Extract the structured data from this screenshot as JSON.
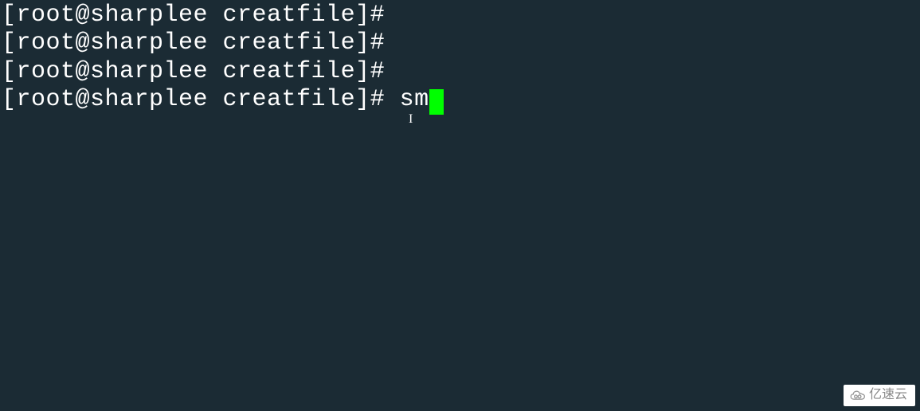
{
  "terminal": {
    "lines": [
      {
        "prompt": "[root@sharplee creatfile]# ",
        "command": ""
      },
      {
        "prompt": "[root@sharplee creatfile]# ",
        "command": ""
      },
      {
        "prompt": "[root@sharplee creatfile]# ",
        "command": ""
      },
      {
        "prompt": "[root@sharplee creatfile]# ",
        "command": "sm"
      }
    ],
    "cursor_color": "#00ff00",
    "background": "#1b2b34",
    "foreground": "#ffffff"
  },
  "text_cursor_mark": "I",
  "watermark": {
    "text": "亿速云"
  }
}
